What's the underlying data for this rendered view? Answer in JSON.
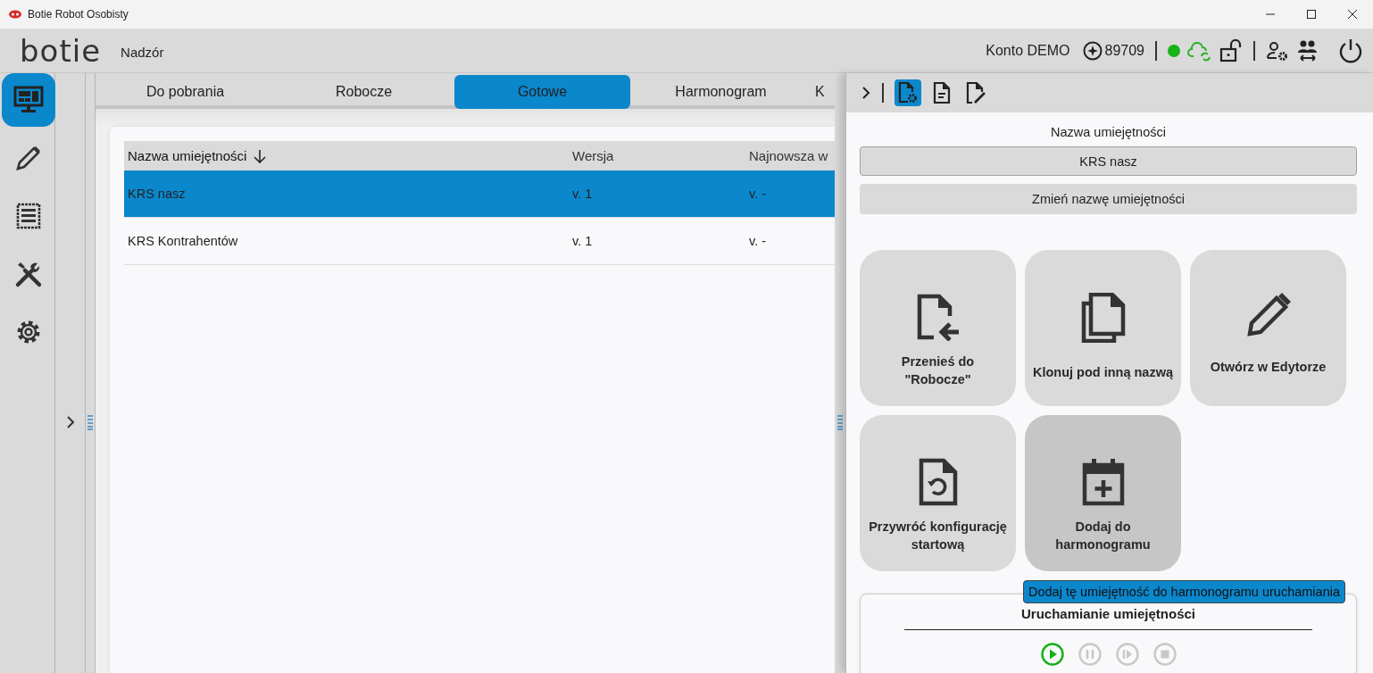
{
  "window": {
    "title": "Botie Robot Osobisty"
  },
  "header": {
    "logo": "botie",
    "section": "Nadzór",
    "account": "Konto DEMO",
    "credits": "89709",
    "online": true
  },
  "sidebar": {
    "items": [
      {
        "kind": "monitor",
        "selected": true
      },
      {
        "kind": "pencil",
        "selected": false
      },
      {
        "kind": "receipt",
        "selected": false
      },
      {
        "kind": "tools",
        "selected": false
      },
      {
        "kind": "gear",
        "selected": false
      }
    ]
  },
  "tabs": [
    {
      "label": "Do pobrania",
      "selected": false
    },
    {
      "label": "Robocze",
      "selected": false
    },
    {
      "label": "Gotowe",
      "selected": true
    },
    {
      "label": "Harmonogram",
      "selected": false
    },
    {
      "label": "K",
      "selected": false
    }
  ],
  "table": {
    "columns": [
      {
        "label": "Nazwa umiejętności",
        "sorted": true
      },
      {
        "label": "Wersja",
        "sorted": false
      },
      {
        "label": "Najnowsza w",
        "sorted": false
      }
    ],
    "rows": [
      {
        "cells": [
          "KRS nasz",
          "v. 1",
          "v. -"
        ],
        "selected": true
      },
      {
        "cells": [
          "KRS Kontrahentów",
          "v. 1",
          "v. -"
        ],
        "selected": false
      }
    ]
  },
  "panel": {
    "toolbar": [
      {
        "kind": "doc-gear",
        "selected": true
      },
      {
        "kind": "doc-lines",
        "selected": false
      },
      {
        "kind": "doc-pen",
        "selected": false
      }
    ],
    "name_label": "Nazwa umiejętności",
    "name_value": "KRS nasz",
    "rename_button": "Zmień nazwę umiejętności",
    "actions": [
      {
        "kind": "move",
        "label": "Przenieś do \"Robocze\"",
        "hovered": false
      },
      {
        "kind": "clone",
        "label": "Klonuj pod inną nazwą",
        "hovered": false
      },
      {
        "kind": "edit",
        "label": "Otwórz w Edytorze",
        "hovered": false
      },
      {
        "kind": "restore",
        "label": "Przywróć konfigurację startową",
        "hovered": false
      },
      {
        "kind": "schedule",
        "label": "Dodaj do harmonogramu",
        "hovered": true
      }
    ],
    "tooltip": "Dodaj tę umiejętność do harmonogramu uruchamiania",
    "run": {
      "title": "Uruchamianie umiejętności",
      "controls": [
        {
          "kind": "play",
          "disabled": false
        },
        {
          "kind": "pause",
          "disabled": true
        },
        {
          "kind": "step",
          "disabled": true
        },
        {
          "kind": "stop",
          "disabled": true
        }
      ]
    }
  }
}
